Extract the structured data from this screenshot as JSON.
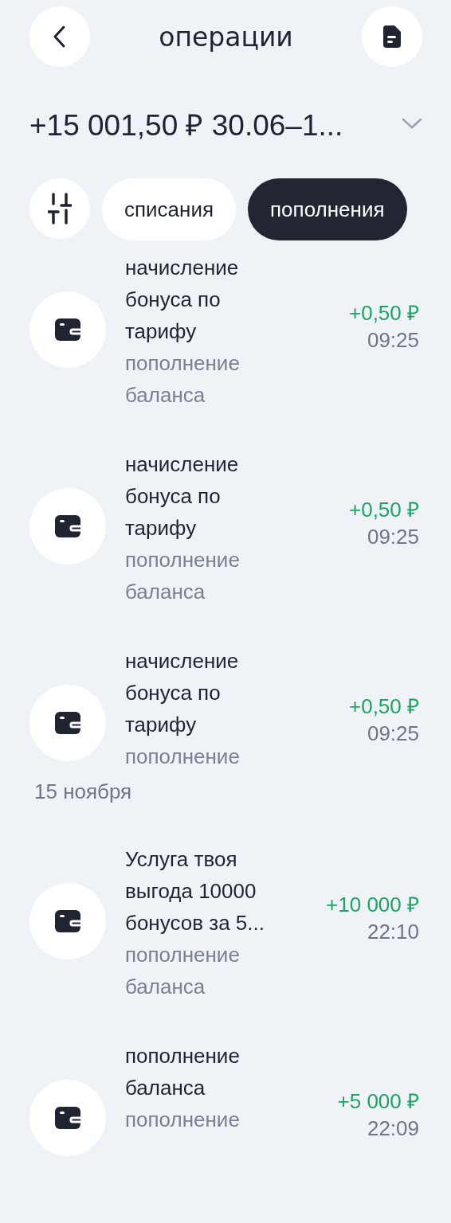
{
  "header": {
    "title": "операции"
  },
  "summary": {
    "text": "+15 001,50 ₽ 30.06–1..."
  },
  "filters": [
    {
      "label": "списания",
      "selected": false
    },
    {
      "label": "пополнения",
      "selected": true
    }
  ],
  "groups": [
    {
      "rows": [
        {
          "title": "начисление бонуса по тарифу",
          "subtitle": "пополнение баланса",
          "amount": "+0,50 ₽",
          "time": "09:25"
        },
        {
          "title": "начисление бонуса по тарифу",
          "subtitle": "пополнение баланса",
          "amount": "+0,50 ₽",
          "time": "09:25"
        },
        {
          "title": "начисление бонуса по тарифу",
          "subtitle": "пополнение",
          "amount": "+0,50 ₽",
          "time": "09:25"
        }
      ]
    },
    {
      "date": "15 ноября",
      "rows": [
        {
          "title": "Услуга твоя выгода 10000 бонусов за 5...",
          "subtitle": "пополнение баланса",
          "amount": "+10 000 ₽",
          "time": "22:10"
        },
        {
          "title": "пополнение баланса",
          "subtitle": "пополнение",
          "amount": "+5 000 ₽",
          "time": "22:09"
        }
      ]
    }
  ]
}
